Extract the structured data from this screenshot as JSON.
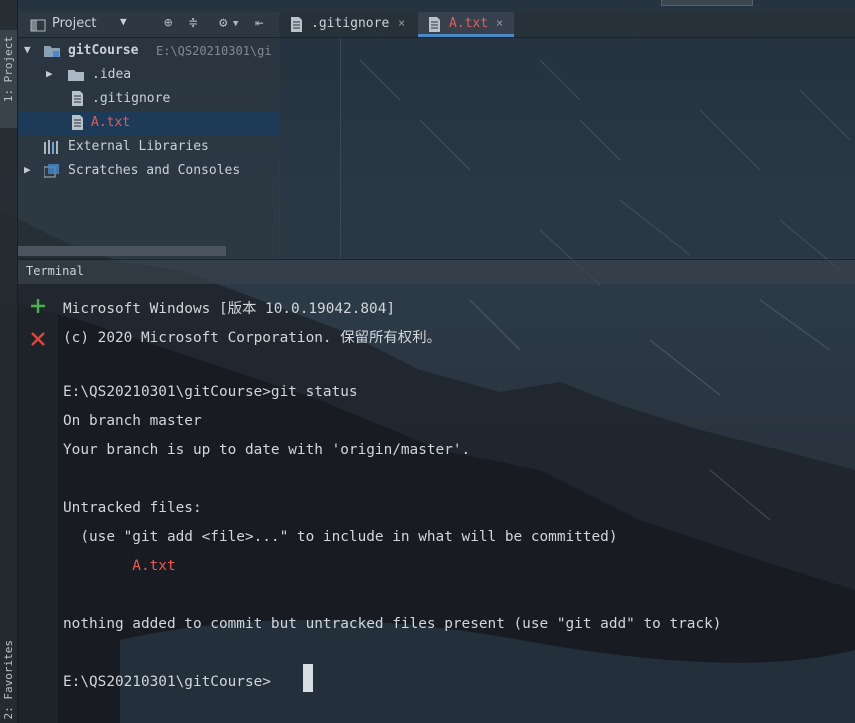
{
  "sidebar": {
    "project_tab": "1: Project",
    "favorites_tab": "2: Favorites"
  },
  "project_panel": {
    "title": "Project",
    "tree": [
      {
        "label": "gitCourse",
        "path": "E:\\QS20210301\\gi",
        "type": "module"
      },
      {
        "label": ".idea",
        "type": "folder"
      },
      {
        "label": ".gitignore",
        "type": "file"
      },
      {
        "label": "A.txt",
        "type": "file",
        "selected": true
      },
      {
        "label": "External Libraries",
        "type": "libraries"
      },
      {
        "label": "Scratches and Consoles",
        "type": "scratches"
      }
    ]
  },
  "editor": {
    "tabs": [
      {
        "label": ".gitignore",
        "close": "×"
      },
      {
        "label": "A.txt",
        "close": "×",
        "active": true
      }
    ]
  },
  "terminal": {
    "title": "Terminal",
    "lines": [
      "Microsoft Windows [版本 10.0.19042.804]",
      "(c) 2020 Microsoft Corporation. 保留所有权利。",
      "",
      "E:\\QS20210301\\gitCourse>git status",
      "On branch master",
      "Your branch is up to date with 'origin/master'.",
      "",
      "Untracked files:",
      "  (use \"git add <file>...\" to include in what will be committed)",
      "        A.txt",
      "",
      "nothing added to commit but untracked files present (use \"git add\" to track)",
      "",
      "E:\\QS20210301\\gitCourse>"
    ]
  },
  "colors": {
    "untracked": "#ea5a55",
    "selection": "#1d3b59",
    "add": "#4caf50",
    "close": "#e0463e"
  }
}
